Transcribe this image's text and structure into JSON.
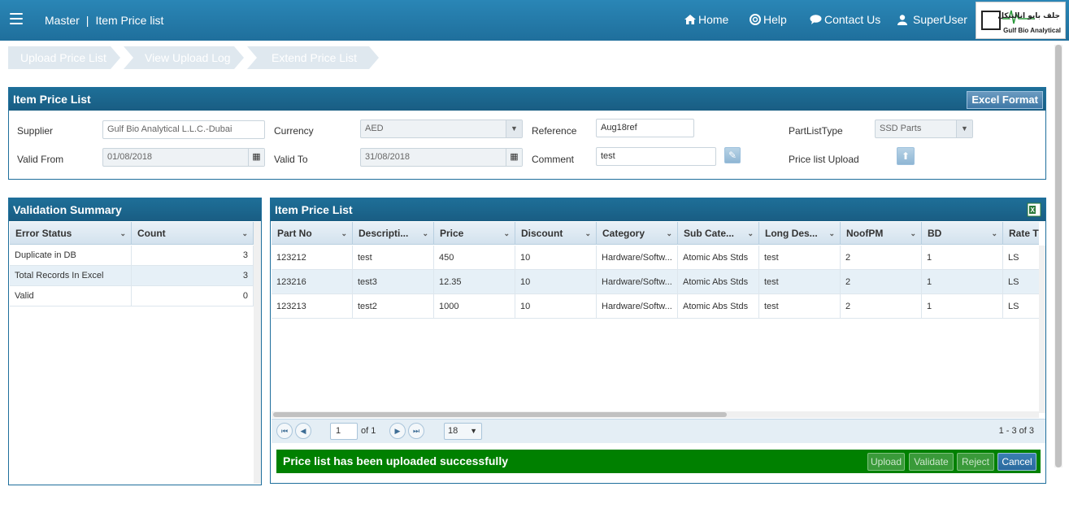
{
  "header": {
    "crumb_root": "Master",
    "crumb_sep": "|",
    "crumb_page": "Item Price list",
    "nav": {
      "home": "Home",
      "help": "Help",
      "contact": "Contact Us",
      "user": "SuperUser"
    },
    "logo": {
      "arabic": "جلف بايو انالتيكل",
      "english": "Gulf Bio Analytical"
    }
  },
  "steps": [
    "Upload Price List",
    "View Upload Log",
    "Extend Price List"
  ],
  "form": {
    "title": "Item Price List",
    "excel_format": "Excel Format",
    "supplier_label": "Supplier",
    "supplier_value": "Gulf Bio Analytical L.L.C.-Dubai",
    "currency_label": "Currency",
    "currency_value": "AED",
    "reference_label": "Reference",
    "reference_value": "Aug18ref",
    "partlisttype_label": "PartListType",
    "partlisttype_value": "SSD Parts",
    "validfrom_label": "Valid From",
    "validfrom_value": "01/08/2018",
    "validto_label": "Valid To",
    "validto_value": "31/08/2018",
    "comment_label": "Comment",
    "comment_value": "test",
    "upload_label": "Price list Upload"
  },
  "validation": {
    "title": "Validation Summary",
    "col_status": "Error Status",
    "col_count": "Count",
    "rows": [
      {
        "status": "Duplicate in DB",
        "count": "3"
      },
      {
        "status": "Total Records In Excel",
        "count": "3"
      },
      {
        "status": "Valid",
        "count": "0"
      }
    ]
  },
  "items": {
    "title": "Item Price List",
    "columns": [
      "Part No",
      "Descripti...",
      "Price",
      "Discount",
      "Category",
      "Sub Cate...",
      "Long Des...",
      "NoofPM",
      "BD",
      "Rate T"
    ],
    "rows": [
      [
        "123212",
        "test",
        "450",
        "10",
        "Hardware/Softw...",
        "Atomic Abs Stds",
        "test",
        "2",
        "1",
        "LS"
      ],
      [
        "123216",
        "test3",
        "12.35",
        "10",
        "Hardware/Softw...",
        "Atomic Abs Stds",
        "test",
        "2",
        "1",
        "LS"
      ],
      [
        "123213",
        "test2",
        "1000",
        "10",
        "Hardware/Softw...",
        "Atomic Abs Stds",
        "test",
        "2",
        "1",
        "LS"
      ]
    ]
  },
  "pager": {
    "page": "1",
    "of": "of 1",
    "page_size": "18",
    "summary": "1 - 3 of 3"
  },
  "message": "Price list has been uploaded successfully",
  "actions": {
    "upload": "Upload",
    "validate": "Validate",
    "reject": "Reject",
    "cancel": "Cancel"
  }
}
